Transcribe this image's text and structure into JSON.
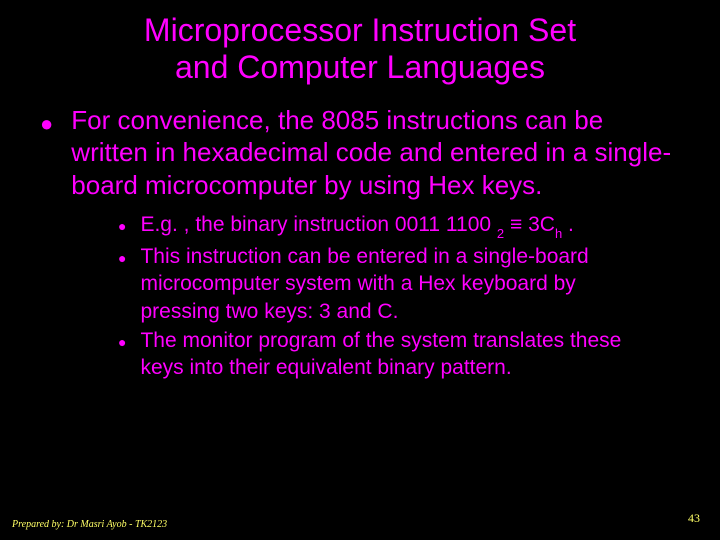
{
  "title_line1": "Microprocessor Instruction Set",
  "title_line2": "and Computer Languages",
  "main_bullet": "For convenience, the 8085 instructions can be written in hexadecimal code and entered in a single-board microcomputer by using Hex keys.",
  "sub": {
    "s1_a": "E.g. , the binary instruction 0011 1100 ",
    "s1_sub1": "2",
    "s1_b": " ≡ 3C",
    "s1_sub2": "h",
    "s1_c": " .",
    "s2": "This instruction can be entered in a single-board microcomputer system with a Hex keyboard by pressing two keys: 3 and C.",
    "s3": "The monitor program of the system translates these keys into their equivalent binary pattern."
  },
  "footer_left": "Prepared by: Dr Masri Ayob - TK2123",
  "footer_right": "43"
}
